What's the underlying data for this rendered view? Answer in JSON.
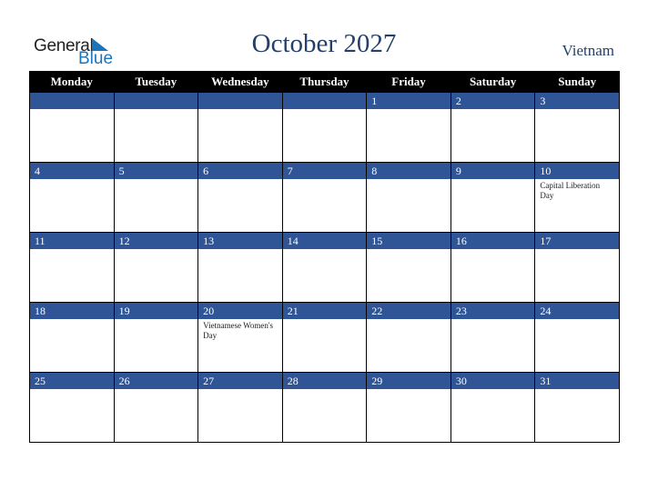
{
  "logo": {
    "line1": "General",
    "line2": "Blue"
  },
  "header": {
    "title": "October 2027",
    "country": "Vietnam"
  },
  "weekdays": [
    "Monday",
    "Tuesday",
    "Wednesday",
    "Thursday",
    "Friday",
    "Saturday",
    "Sunday"
  ],
  "weeks": [
    [
      {
        "day": ""
      },
      {
        "day": ""
      },
      {
        "day": ""
      },
      {
        "day": ""
      },
      {
        "day": "1"
      },
      {
        "day": "2"
      },
      {
        "day": "3"
      }
    ],
    [
      {
        "day": "4"
      },
      {
        "day": "5"
      },
      {
        "day": "6"
      },
      {
        "day": "7"
      },
      {
        "day": "8"
      },
      {
        "day": "9"
      },
      {
        "day": "10",
        "event": "Capital Liberation Day"
      }
    ],
    [
      {
        "day": "11"
      },
      {
        "day": "12"
      },
      {
        "day": "13"
      },
      {
        "day": "14"
      },
      {
        "day": "15"
      },
      {
        "day": "16"
      },
      {
        "day": "17"
      }
    ],
    [
      {
        "day": "18"
      },
      {
        "day": "19"
      },
      {
        "day": "20",
        "event": "Vietnamese Women's Day"
      },
      {
        "day": "21"
      },
      {
        "day": "22"
      },
      {
        "day": "23"
      },
      {
        "day": "24"
      }
    ],
    [
      {
        "day": "25"
      },
      {
        "day": "26"
      },
      {
        "day": "27"
      },
      {
        "day": "28"
      },
      {
        "day": "29"
      },
      {
        "day": "30"
      },
      {
        "day": "31"
      }
    ]
  ],
  "colors": {
    "band": "#2f5597",
    "header_bg": "#000000",
    "title": "#243f6a",
    "logo_blue": "#1a75bc"
  }
}
